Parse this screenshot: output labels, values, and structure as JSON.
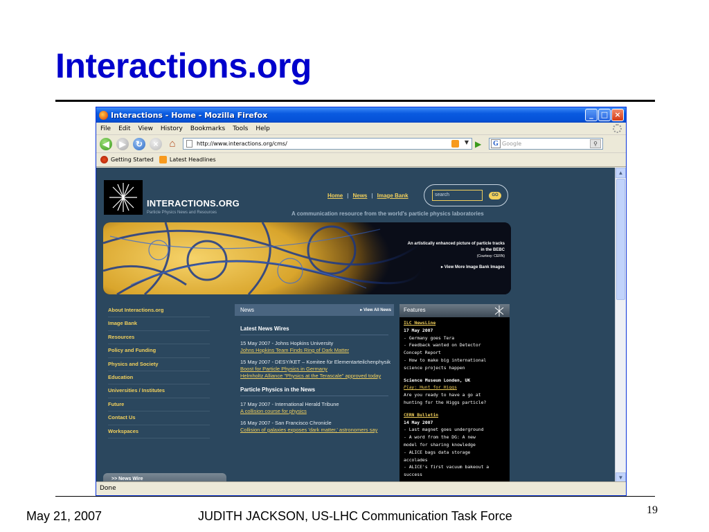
{
  "slide": {
    "title": "Interactions.org",
    "footer_date": "May 21, 2007",
    "footer_center": "JUDITH JACKSON, US-LHC Communication Task Force",
    "page_number": "19"
  },
  "browser": {
    "window_title": "Interactions - Home - Mozilla Firefox",
    "menu": [
      "File",
      "Edit",
      "View",
      "History",
      "Bookmarks",
      "Tools",
      "Help"
    ],
    "url": "http://www.interactions.org/cms/",
    "search_placeholder": "Google",
    "bookmarks": [
      "Getting Started",
      "Latest Headlines"
    ],
    "status": "Done"
  },
  "site": {
    "name": "INTERACTIONS.ORG",
    "subtitle": "Particle Physics News and Resources",
    "top_nav": [
      "Home",
      "News",
      "Image Bank"
    ],
    "search_value": "search",
    "go_label": "GO",
    "tagline": "A communication resource from the world's particle physics laboratories",
    "banner": {
      "caption": "An artistically enhanced picture of particle tracks in the BEBC",
      "credit": "(Courtesy: CERN)",
      "link": "View More Image Bank Images"
    },
    "left_nav": [
      "About Interactions.org",
      "Image Bank",
      "Resources",
      "Policy and Funding",
      "Physics and Society",
      "Education",
      "Universities / Institutes",
      "Future",
      "Contact Us",
      "Workspaces"
    ],
    "newswire_tab": ">> News Wire",
    "news": {
      "header": "News",
      "view_all": "View All News",
      "latest_title": "Latest News Wires",
      "latest": [
        {
          "meta": "15 May 2007 - Johns Hopkins University",
          "links": [
            "Johns Hopkins Team Finds Ring of Dark Matter"
          ]
        },
        {
          "meta": "15 May 2007 - DESY/KET – Komitee für Elementarteilchenphysik",
          "links": [
            "Boost for Particle Physics in Germany",
            "Helmholtz Alliance \"Physics at the Terascale\" approved today"
          ]
        }
      ],
      "pp_title": "Particle Physics in the News",
      "pp_items": [
        {
          "meta": "17 May 2007 - International Herald Tribune",
          "links": [
            "A collision course for physics"
          ]
        },
        {
          "meta": "16 May 2007 - San Francisco Chronicle",
          "links": [
            "Collision of galaxies exposes 'dark matter,' astronomers say"
          ]
        }
      ]
    },
    "features": {
      "header": "Features",
      "blocks": [
        {
          "title": "ILC NewsLine",
          "date": "17 May 2007",
          "lines": [
            "- Germany goes Tera",
            "- Feedback wanted on Detector",
            "Concept Report",
            "- How to make big international",
            "science projects happen"
          ]
        },
        {
          "title": "Science Museum Londen, UK",
          "play": "Play",
          "play_rest": ": Hunt for Higgs",
          "lines": [
            "Are you ready to have a go at",
            "hunting for the Higgs particle?"
          ]
        },
        {
          "title": "CERN Bulletin",
          "date": "14 May 2007",
          "lines": [
            "- Last magnet goes underground",
            "- A word from the DG: A new",
            "model for sharing knowledge",
            "- ALICE bags data storage",
            "accolades",
            "- ALICE's first vacuum bakeout a",
            "success"
          ]
        }
      ]
    }
  }
}
